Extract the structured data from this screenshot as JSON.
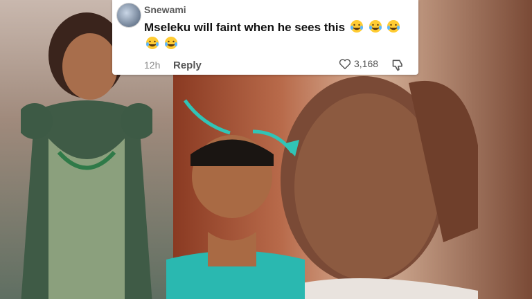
{
  "comment": {
    "username": "Snewami",
    "text": "Mseleku will faint when he sees this",
    "emoji_count": 5,
    "emoji_icon": "crying-laughing-emoji",
    "time": "12h",
    "reply_label": "Reply",
    "like_count": "3,168"
  },
  "colors": {
    "arrow": "#31c4b6",
    "dress_green": "#2f7a48"
  }
}
